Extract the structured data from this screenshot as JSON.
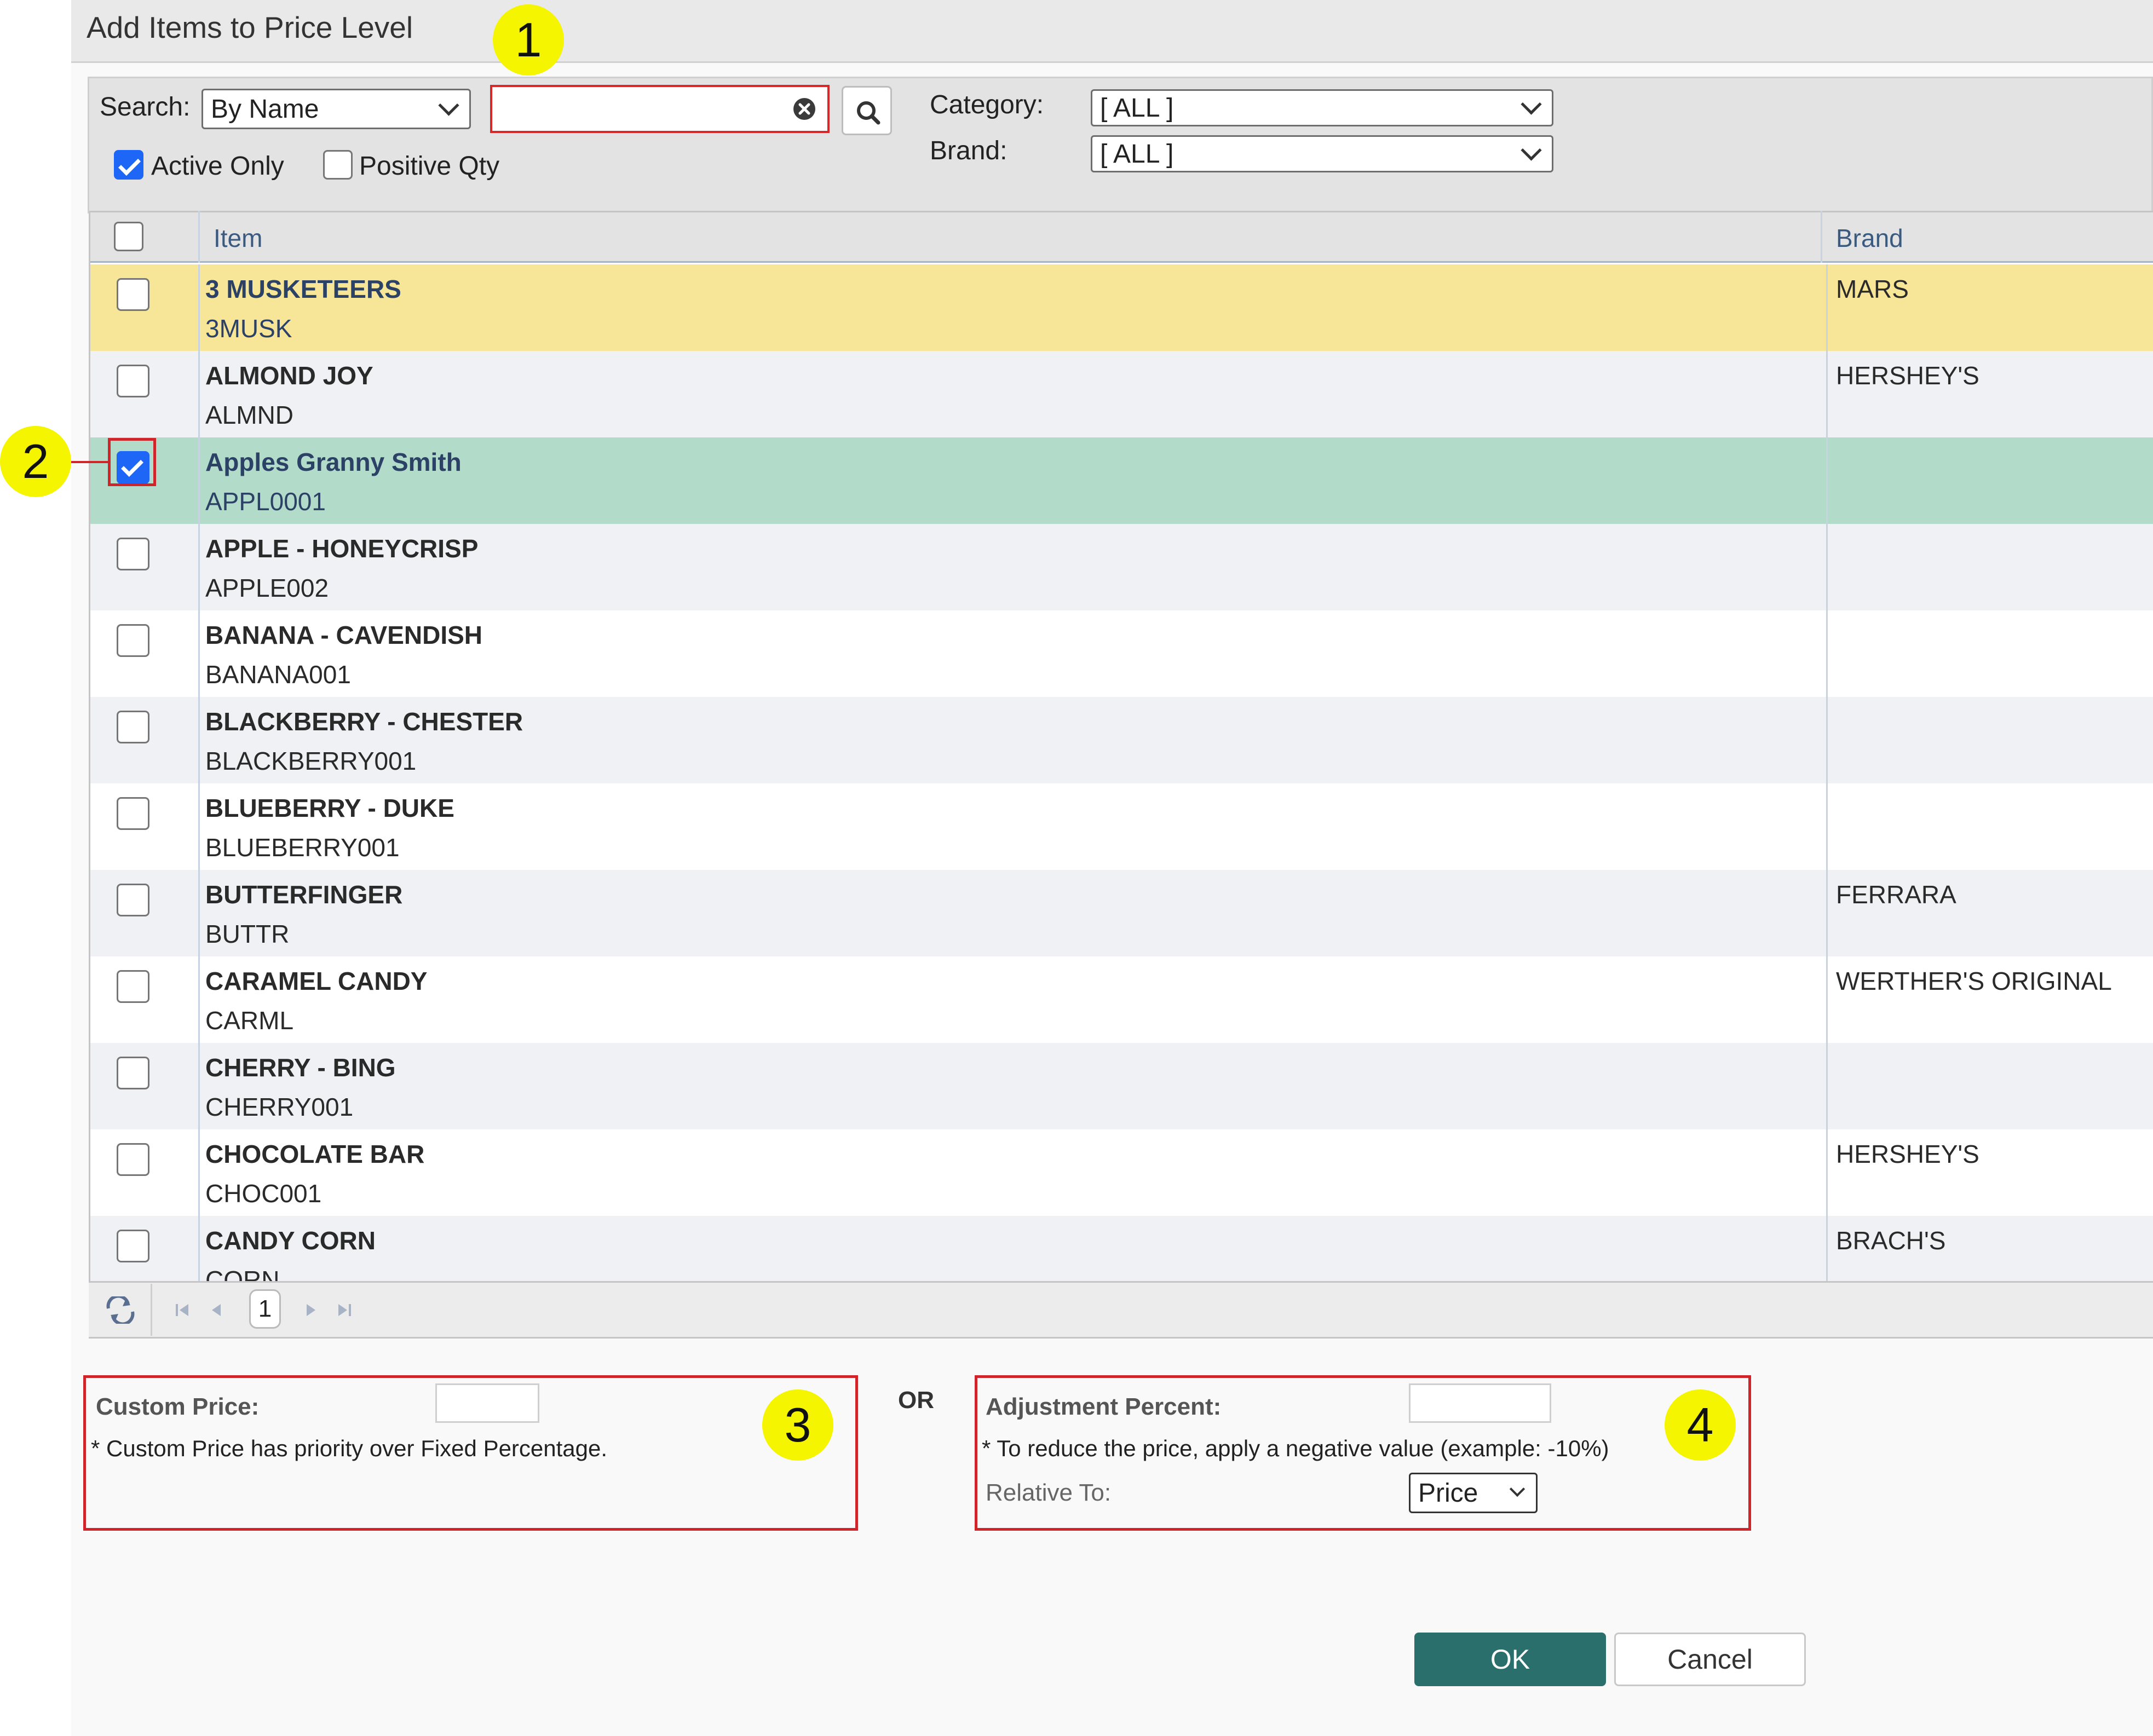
{
  "dialog": {
    "title": "Add Items to Price Level"
  },
  "search": {
    "label": "Search:",
    "mode": "By Name",
    "query": "",
    "placeholder": "",
    "active_only_label": "Active Only",
    "active_only_checked": true,
    "positive_qty_label": "Positive Qty",
    "positive_qty_checked": false
  },
  "filters": {
    "category_label": "Category:",
    "category_value": "[ ALL ]",
    "brand_label": "Brand:",
    "brand_value": "[ ALL ]"
  },
  "grid": {
    "columns": [
      "Item",
      "Brand"
    ],
    "rows": [
      {
        "name": "3 MUSKETEERS",
        "code": "3MUSK",
        "brand": "MARS",
        "checked": false,
        "state": "highlighted"
      },
      {
        "name": "ALMOND JOY",
        "code": "ALMND",
        "brand": "HERSHEY'S",
        "checked": false,
        "state": "normal"
      },
      {
        "name": "Apples Granny Smith",
        "code": "APPL0001",
        "brand": "",
        "checked": true,
        "state": "selected"
      },
      {
        "name": "APPLE - HONEYCRISP",
        "code": "APPLE002",
        "brand": "",
        "checked": false,
        "state": "normal"
      },
      {
        "name": "BANANA - CAVENDISH",
        "code": "BANANA001",
        "brand": "",
        "checked": false,
        "state": "normal"
      },
      {
        "name": "BLACKBERRY - CHESTER",
        "code": "BLACKBERRY001",
        "brand": "",
        "checked": false,
        "state": "normal"
      },
      {
        "name": "BLUEBERRY - DUKE",
        "code": "BLUEBERRY001",
        "brand": "",
        "checked": false,
        "state": "normal"
      },
      {
        "name": "BUTTERFINGER",
        "code": "BUTTR",
        "brand": "FERRARA",
        "checked": false,
        "state": "normal"
      },
      {
        "name": "CARAMEL CANDY",
        "code": "CARML",
        "brand": "WERTHER'S ORIGINAL",
        "checked": false,
        "state": "normal"
      },
      {
        "name": "CHERRY - BING",
        "code": "CHERRY001",
        "brand": "",
        "checked": false,
        "state": "normal"
      },
      {
        "name": "CHOCOLATE BAR",
        "code": "CHOC001",
        "brand": "HERSHEY'S",
        "checked": false,
        "state": "normal"
      },
      {
        "name": "CANDY CORN",
        "code": "CORN",
        "brand": "BRACH'S",
        "checked": false,
        "state": "normal"
      }
    ]
  },
  "pager": {
    "current_page": "1",
    "refresh_icon": "refresh-icon"
  },
  "custom_price": {
    "label": "Custom Price:",
    "value": "",
    "note": "* Custom Price has priority over Fixed Percentage."
  },
  "or_label": "OR",
  "adjustment": {
    "label": "Adjustment Percent:",
    "value": "",
    "note": "* To reduce the price, apply a negative value (example: -10%)",
    "relative_label": "Relative To:",
    "relative_value": "Price"
  },
  "actions": {
    "ok": "OK",
    "cancel": "Cancel"
  },
  "callouts": [
    "1",
    "2",
    "3",
    "4"
  ],
  "colors": {
    "accent": "#2a6f6c",
    "highlight_row": "#f7e598",
    "selected_row": "#b3dbc9",
    "callout": "#f5f500",
    "annotation_red": "#d0242b",
    "checkbox_checked": "#1e66f5"
  }
}
